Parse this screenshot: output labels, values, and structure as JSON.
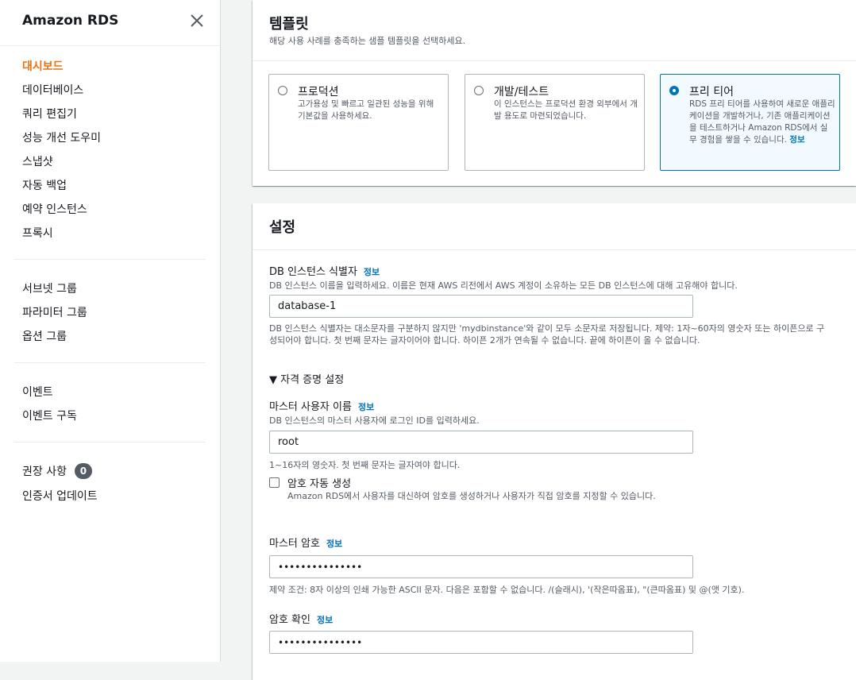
{
  "sidebar": {
    "title": "Amazon RDS",
    "close_icon": "close-icon",
    "group1": [
      "대시보드",
      "데이터베이스",
      "쿼리 편집기",
      "성능 개선 도우미",
      "스냅샷",
      "자동 백업",
      "예약 인스턴스",
      "프록시"
    ],
    "group2": [
      "서브넷 그룹",
      "파라미터 그룹",
      "옵션 그룹"
    ],
    "group3": [
      "이벤트",
      "이벤트 구독"
    ],
    "group4": {
      "recommendations_label": "권장 사항",
      "recommendations_count": "0",
      "cert_update": "인증서 업데이트"
    },
    "active_item": "대시보드"
  },
  "templates": {
    "title": "템플릿",
    "description": "해당 사용 사례를 충족하는 샘플 템플릿을 선택하세요.",
    "options": [
      {
        "title": "프로덕션",
        "desc": "고가용성 및 빠르고 일관된 성능을 위해 기본값을 사용하세요.",
        "selected": false
      },
      {
        "title": "개발/테스트",
        "desc": "이 인스턴스는 프로덕션 환경 외부에서 개발 용도로 마련되었습니다.",
        "selected": false
      },
      {
        "title": "프리 티어",
        "desc": "RDS 프리 티어를 사용하여 새로운 애플리케이션을 개발하거나, 기존 애플리케이션을 테스트하거나 Amazon RDS에서 실무 경험을 쌓을 수 있습니다.",
        "info": "정보",
        "selected": true
      }
    ]
  },
  "settings": {
    "title": "설정",
    "db_identifier": {
      "label": "DB 인스턴스 식별자",
      "info": "정보",
      "description": "DB 인스턴스 이름을 입력하세요. 이름은 현재 AWS 리전에서 AWS 계정이 소유하는 모든 DB 인스턴스에 대해 고유해야 합니다.",
      "value": "database-1",
      "constraint": "DB 인스턴스 식별자는 대소문자를 구분하지 않지만 'mydbinstance'와 같이 모두 소문자로 저장됩니다. 제약: 1자~60자의 영숫자 또는 하이픈으로 구성되어야 합니다. 첫 번째 문자는 글자이어야 합니다. 하이픈 2개가 연속될 수 없습니다. 끝에 하이픈이 올 수 없습니다."
    },
    "credentials": {
      "expander_label": "▼ 자격 증명 설정",
      "master_username": {
        "label": "마스터 사용자 이름",
        "info": "정보",
        "description": "DB 인스턴스의 마스터 사용자에 로그인 ID를 입력하세요.",
        "value": "root",
        "constraint": "1~16자의 영숫자. 첫 번째 문자는 글자여야 합니다."
      },
      "auto_password": {
        "label": "암호 자동 생성",
        "description": "Amazon RDS에서 사용자를 대신하여 암호를 생성하거나 사용자가 직접 암호를 지정할 수 있습니다.",
        "checked": false
      },
      "master_password": {
        "label": "마스터 암호",
        "info": "정보",
        "value": "•••••••••••••••",
        "constraint": "제약 조건: 8자 이상의 인쇄 가능한 ASCII 문자. 다음은 포함할 수 없습니다. /(슬래시), '(작은따옴표), \"(큰따옴표) 및 @(앳 기호)."
      },
      "confirm_password": {
        "label": "암호 확인",
        "info": "정보",
        "value": "•••••••••••••••"
      }
    }
  },
  "colors": {
    "accent_orange": "#ec7211",
    "link_blue": "#0073bb",
    "badge_gray": "#545b64"
  }
}
